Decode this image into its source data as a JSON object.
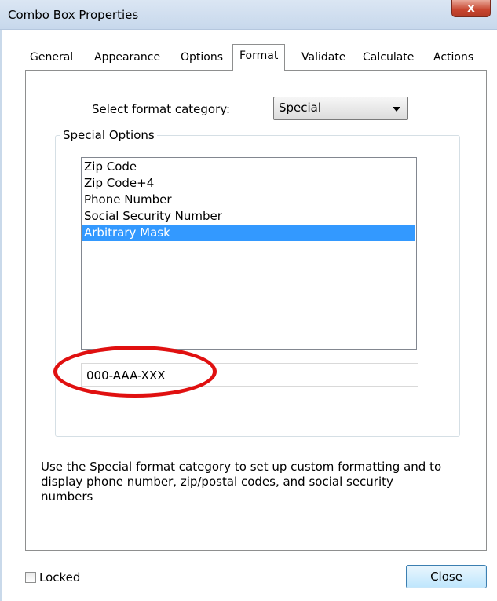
{
  "window": {
    "title": "Combo Box Properties",
    "close_icon_glyph": "x"
  },
  "tabs": [
    {
      "label": "General"
    },
    {
      "label": "Appearance"
    },
    {
      "label": "Options"
    },
    {
      "label": "Format",
      "active": true
    },
    {
      "label": "Validate"
    },
    {
      "label": "Calculate"
    },
    {
      "label": "Actions"
    }
  ],
  "format": {
    "select_label": "Select format category:",
    "selected_category": "Special"
  },
  "special_options": {
    "legend": "Special Options",
    "items": [
      {
        "label": "Zip Code"
      },
      {
        "label": "Zip Code+4"
      },
      {
        "label": "Phone Number"
      },
      {
        "label": "Social Security Number"
      },
      {
        "label": "Arbitrary Mask",
        "selected": true
      }
    ],
    "mask_value": "000-AAA-XXX",
    "annotation_color": "#e01010"
  },
  "help_text": "Use the Special format category to set up custom formatting and to display phone number, zip/postal codes, and social security numbers",
  "footer": {
    "locked_label": "Locked",
    "locked_checked": false,
    "close_label": "Close"
  },
  "colors": {
    "selection": "#3399ff",
    "titlebar": "#c7d8ec"
  }
}
